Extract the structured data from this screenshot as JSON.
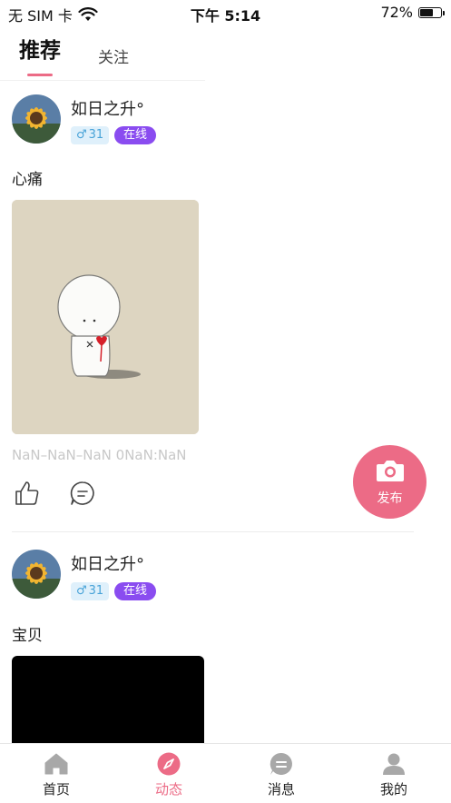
{
  "status_bar": {
    "carrier": "无 SIM 卡",
    "time": "下午 5:14",
    "battery_percent": "72%",
    "battery_level": 0.72
  },
  "tabs": [
    {
      "label": "推荐",
      "active": true
    },
    {
      "label": "关注",
      "active": false
    }
  ],
  "posts": [
    {
      "username": "如日之升°",
      "gender_badge": "31",
      "online_badge": "在线",
      "text": "心痛",
      "timestamp": "NaN–NaN–NaN 0NaN:NaN"
    },
    {
      "username": "如日之升°",
      "gender_badge": "31",
      "online_badge": "在线",
      "text": "宝贝"
    }
  ],
  "fab": {
    "label": "发布"
  },
  "bottom_nav": [
    {
      "label": "首页",
      "icon": "home-icon",
      "active": false
    },
    {
      "label": "动态",
      "icon": "compass-icon",
      "active": true
    },
    {
      "label": "消息",
      "icon": "message-icon",
      "active": false
    },
    {
      "label": "我的",
      "icon": "profile-icon",
      "active": false
    }
  ],
  "colors": {
    "accent": "#ec6b86",
    "online_badge": "#8a4cf0",
    "gender_badge_bg": "#dff0fb",
    "gender_badge_text": "#49a3d8"
  }
}
